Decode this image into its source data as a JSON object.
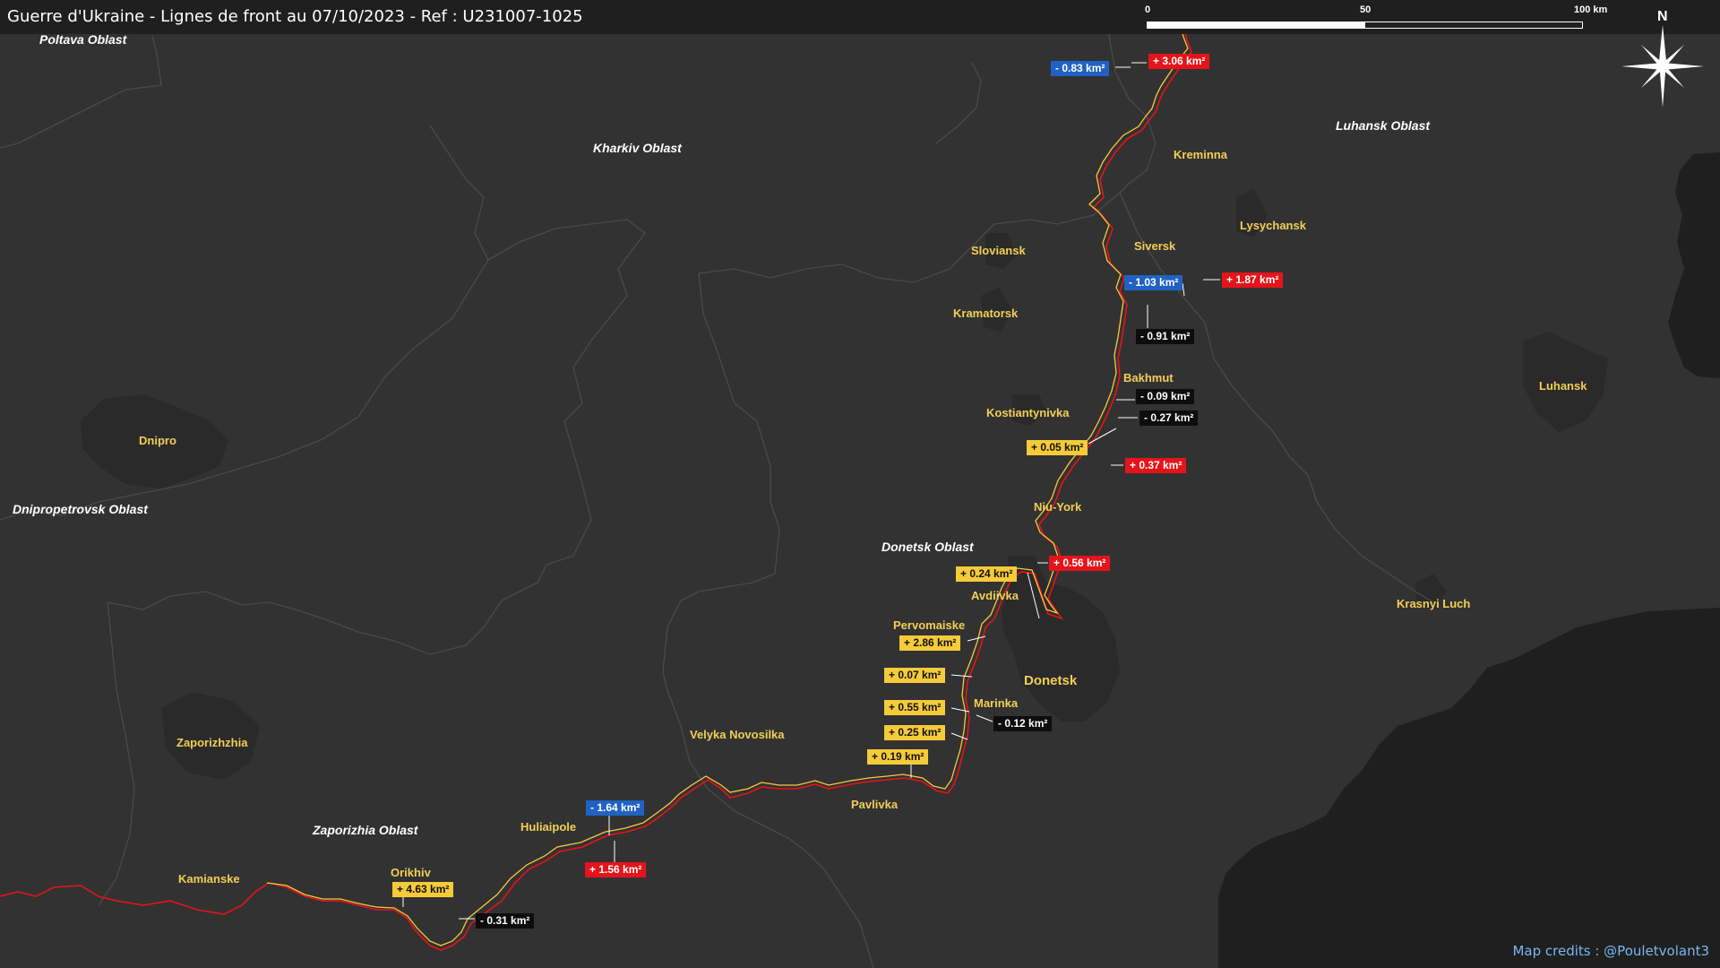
{
  "title": "Guerre d'Ukraine - Lignes de front au 07/10/2023 - Ref : U231007-1025",
  "scale": {
    "ticks": [
      "0",
      "50",
      "100 km"
    ]
  },
  "compass": {
    "label": "N",
    "icon": "compass-rose-icon"
  },
  "credit": "Map credits : @Pouletvolant3",
  "colors": {
    "land": "#323232",
    "occupied": "#232323",
    "front_red": "#e5141b",
    "front_yellow": "#f5cb3a",
    "city_label": "#f3cf55"
  },
  "oblasts": [
    "Poltava Oblast",
    "Kharkiv Oblast",
    "Luhansk Oblast",
    "Dnipropetrovsk Oblast",
    "Donetsk Oblast",
    "Zaporizhia Oblast"
  ],
  "cities": [
    "Kreminna",
    "Lysychansk",
    "Siversk",
    "Sloviansk",
    "Kramatorsk",
    "Bakhmut",
    "Kostiantynivka",
    "Luhansk",
    "Dnipro",
    "Niu-York",
    "Avdiivka",
    "Pervomaiske",
    "Donetsk",
    "Marinka",
    "Krasnyi Luch",
    "Zaporizhzhia",
    "Velyka Novosilka",
    "Pavlivka",
    "Huliaipole",
    "Orikhiv",
    "Kamianske"
  ],
  "changes": [
    {
      "text": "- 0.83 km²",
      "type": "blue"
    },
    {
      "text": "+ 3.06 km²",
      "type": "red"
    },
    {
      "text": "- 1.03 km²",
      "type": "blue"
    },
    {
      "text": "+ 1.87 km²",
      "type": "red"
    },
    {
      "text": "- 0.91 km²",
      "type": "black"
    },
    {
      "text": "- 0.09 km²",
      "type": "black"
    },
    {
      "text": "- 0.27 km²",
      "type": "black"
    },
    {
      "text": "+ 0.05 km²",
      "type": "yellow"
    },
    {
      "text": "+ 0.37 km²",
      "type": "red"
    },
    {
      "text": "+ 0.24 km²",
      "type": "yellow"
    },
    {
      "text": "+ 0.56 km²",
      "type": "red"
    },
    {
      "text": "+ 2.86 km²",
      "type": "yellow"
    },
    {
      "text": "+ 0.07 km²",
      "type": "yellow"
    },
    {
      "text": "+ 0.55 km²",
      "type": "yellow"
    },
    {
      "text": "- 0.12 km²",
      "type": "black"
    },
    {
      "text": "+ 0.25 km²",
      "type": "yellow"
    },
    {
      "text": "+ 0.19 km²",
      "type": "yellow"
    },
    {
      "text": "- 1.64 km²",
      "type": "blue"
    },
    {
      "text": "+ 1.56 km²",
      "type": "red"
    },
    {
      "text": "+ 4.63 km²",
      "type": "yellow"
    },
    {
      "text": "- 0.31 km²",
      "type": "black"
    }
  ]
}
